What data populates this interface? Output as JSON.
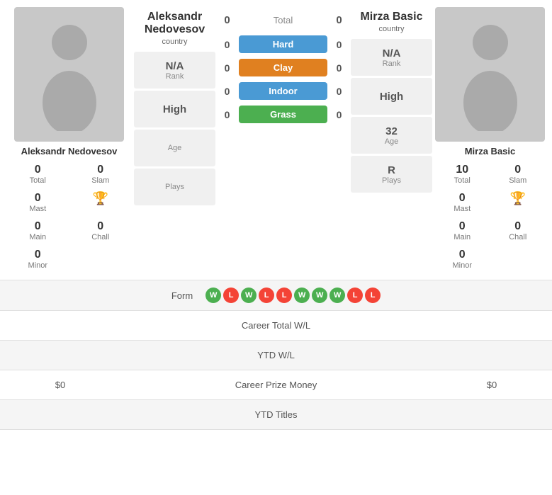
{
  "players": {
    "left": {
      "name": "Aleksandr Nedovesov",
      "name_short": "Aleksandr Nedovesov",
      "country": "country",
      "rank_label": "Rank",
      "rank_value": "N/A",
      "high_label": "High",
      "high_value": "High",
      "age_label": "Age",
      "age_value": "",
      "plays_label": "Plays",
      "plays_value": "",
      "stats": {
        "total_value": "0",
        "total_label": "Total",
        "slam_value": "0",
        "slam_label": "Slam",
        "mast_value": "0",
        "mast_label": "Mast",
        "main_value": "0",
        "main_label": "Main",
        "chall_value": "0",
        "chall_label": "Chall",
        "minor_value": "0",
        "minor_label": "Minor"
      }
    },
    "right": {
      "name": "Mirza Basic",
      "name_short": "Mirza Basic",
      "country": "country",
      "rank_label": "Rank",
      "rank_value": "N/A",
      "high_label": "High",
      "high_value": "High",
      "age_label": "Age",
      "age_value": "32",
      "plays_label": "Plays",
      "plays_value": "R",
      "stats": {
        "total_value": "10",
        "total_label": "Total",
        "slam_value": "0",
        "slam_label": "Slam",
        "mast_value": "0",
        "mast_label": "Mast",
        "main_value": "0",
        "main_label": "Main",
        "chall_value": "0",
        "chall_label": "Chall",
        "minor_value": "0",
        "minor_label": "Minor"
      }
    }
  },
  "courts": {
    "total_label": "Total",
    "total_left": "0",
    "total_right": "0",
    "surfaces": [
      {
        "name": "Hard",
        "class": "surface-hard",
        "left": "0",
        "right": "0"
      },
      {
        "name": "Clay",
        "class": "surface-clay",
        "left": "0",
        "right": "0"
      },
      {
        "name": "Indoor",
        "class": "surface-indoor",
        "left": "0",
        "right": "0"
      },
      {
        "name": "Grass",
        "class": "surface-grass",
        "left": "0",
        "right": "0"
      }
    ]
  },
  "bottom_rows": {
    "form_label": "Form",
    "form_sequence": [
      "W",
      "L",
      "W",
      "L",
      "L",
      "W",
      "W",
      "W",
      "L",
      "L"
    ],
    "career_total_label": "Career Total W/L",
    "ytd_wl_label": "YTD W/L",
    "career_prize_label": "Career Prize Money",
    "career_prize_left": "$0",
    "career_prize_right": "$0",
    "ytd_titles_label": "YTD Titles"
  }
}
